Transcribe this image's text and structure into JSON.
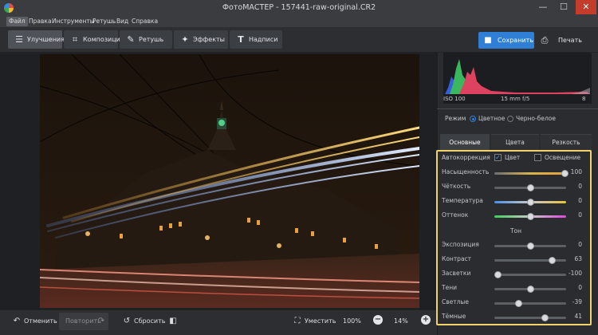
{
  "window": {
    "title": "ФотоМАСТЕР - 157441-raw-original.CR2",
    "controls": [
      "—",
      "☐",
      "✕"
    ]
  },
  "menu": [
    "Файл",
    "Правка",
    "Инструменты",
    "Ретушь",
    "Вид",
    "Справка"
  ],
  "toolbar": {
    "tabs": [
      {
        "label": "Улучшения",
        "icon": "sliders-icon"
      },
      {
        "label": "Композиция",
        "icon": "crop-icon"
      },
      {
        "label": "Ретушь",
        "icon": "brush-icon"
      },
      {
        "label": "Эффекты",
        "icon": "magic-wand-icon"
      },
      {
        "label": "Надписи",
        "icon": "text-icon"
      }
    ],
    "active_tab": "Улучшения",
    "save_label": "Сохранить",
    "print_label": "Печать"
  },
  "histogram": {
    "iso": "ISO 100",
    "focal": "15 mm f/5",
    "exposure": "8"
  },
  "mode": {
    "label": "Режим",
    "options": [
      "Цветное",
      "Черно-белое"
    ],
    "selected": "Цветное"
  },
  "panel_tabs": [
    "Основные",
    "Цвета",
    "Резкость"
  ],
  "active_panel_tab": "Основные",
  "auto": {
    "label": "Автокоррекция",
    "color": {
      "label": "Цвет",
      "checked": true
    },
    "light": {
      "label": "Освещение",
      "checked": false
    }
  },
  "sliders_top": [
    {
      "label": "Насыщенность",
      "value": "100",
      "level": 0.98,
      "track": "saturation"
    },
    {
      "label": "Чёткость",
      "value": "0",
      "level": 0.5,
      "track": "plain"
    },
    {
      "label": "Температура",
      "value": "0",
      "level": 0.5,
      "track": "temperature"
    },
    {
      "label": "Оттенок",
      "value": "0",
      "level": 0.5,
      "track": "tint"
    }
  ],
  "tone_label": "Тон",
  "sliders_tone": [
    {
      "label": "Экспозиция",
      "value": "0",
      "level": 0.5
    },
    {
      "label": "Контраст",
      "value": "63",
      "level": 0.8
    },
    {
      "label": "Засветки",
      "value": "-100",
      "level": 0.04
    },
    {
      "label": "Тени",
      "value": "0",
      "level": 0.5
    },
    {
      "label": "Светлые",
      "value": "-39",
      "level": 0.33
    },
    {
      "label": "Тёмные",
      "value": "41",
      "level": 0.7
    }
  ],
  "bottom": {
    "undo": "Отменить",
    "redo": "Повторить",
    "reset": "Сбросить",
    "fit": "Уместить",
    "zoom100": "100%",
    "zoom_current": "14%"
  },
  "colors": {
    "accent": "#2f7fd6",
    "highlight": "#f1d36a"
  }
}
